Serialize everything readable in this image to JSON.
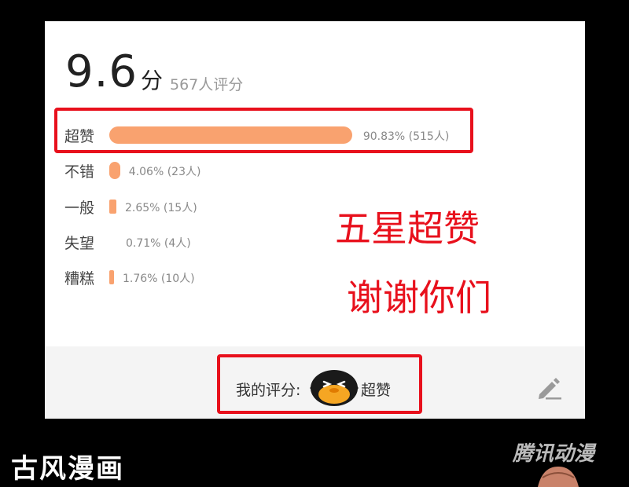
{
  "score": {
    "value": "9.6",
    "unit": "分",
    "count_text": "567人评分"
  },
  "ratings": [
    {
      "label": "超赞",
      "percent": 90.83,
      "stat": "90.83% (515人)"
    },
    {
      "label": "不错",
      "percent": 4.06,
      "stat": "4.06% (23人)"
    },
    {
      "label": "一般",
      "percent": 2.65,
      "stat": "2.65% (15人)"
    },
    {
      "label": "失望",
      "percent": 0.71,
      "stat": "0.71% (4人)"
    },
    {
      "label": "糟糕",
      "percent": 1.76,
      "stat": "1.76% (10人)"
    }
  ],
  "annotations": {
    "line1": "五星超赞",
    "line2": "谢谢你们"
  },
  "my_rating": {
    "label": "我的评分:",
    "value": "超赞"
  },
  "icons": {
    "edit": "pencil-edit-icon",
    "mascot": "mascot-face-icon"
  },
  "logos": {
    "left": "古风漫画",
    "right": "腾讯动漫"
  },
  "colors": {
    "bar": "#f9a26f",
    "highlight": "#e8101c",
    "background": "#000000",
    "card": "#ffffff",
    "footer": "#f4f4f4"
  }
}
